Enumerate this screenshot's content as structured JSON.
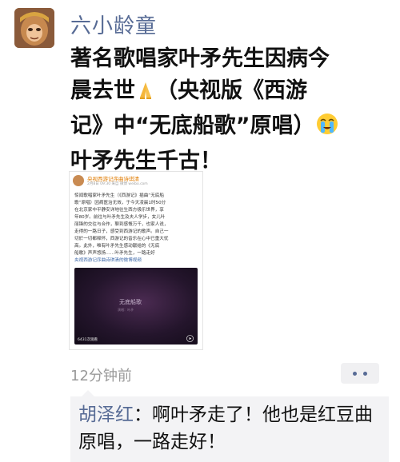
{
  "post": {
    "author": "六小龄童",
    "text_line1": "著名歌唱家叶矛先生因病今",
    "text_line2": "晨去世",
    "text_line2b": "（央视版《西游",
    "text_line3": "记》中“无底船歌”原唱）",
    "text_line4": "叶矛先生千古！",
    "emojis": [
      "pray-emoji",
      "crying-emoji"
    ],
    "timestamp": "12分钟前"
  },
  "embedded_screenshot": {
    "account_name": "央视西游记序曲诗琪清",
    "meta": "2月8日 09:30 来自 微博 weibo.com",
    "body_lines": [
      "惊闻歌唱家叶矛先生（《西游记》插曲“无底船",
      "歌”原唱）因病医治无效，于今天凌晨1时50分",
      "在北京家中平静安详地往生西方极乐世界，享",
      "年80岁。前往与叶矛先生及夫人学步，女儿叶",
      "丽锋的交往与合作，聊到感慨万千，也家人说，",
      "走得的一路日子，感受到西游记的歌声。自己一",
      "切於一切都释怀，西游记的音乐在心中已重大忧",
      "高。此外，唯有叶矛先生感动献给的《无底",
      "船歌》声声悠扬……叶矛先生，一路走好"
    ],
    "link_text": "央视西游记序曲诗琪清的微博视频",
    "video_title": "无底船歌",
    "video_subtitle": "演唱：叶矛",
    "video_views": "6431次观看"
  },
  "comment": {
    "commenter": "胡泽红",
    "separator": "：",
    "text": "啊叶矛走了！他也是红豆曲原唱，一路走好！"
  }
}
